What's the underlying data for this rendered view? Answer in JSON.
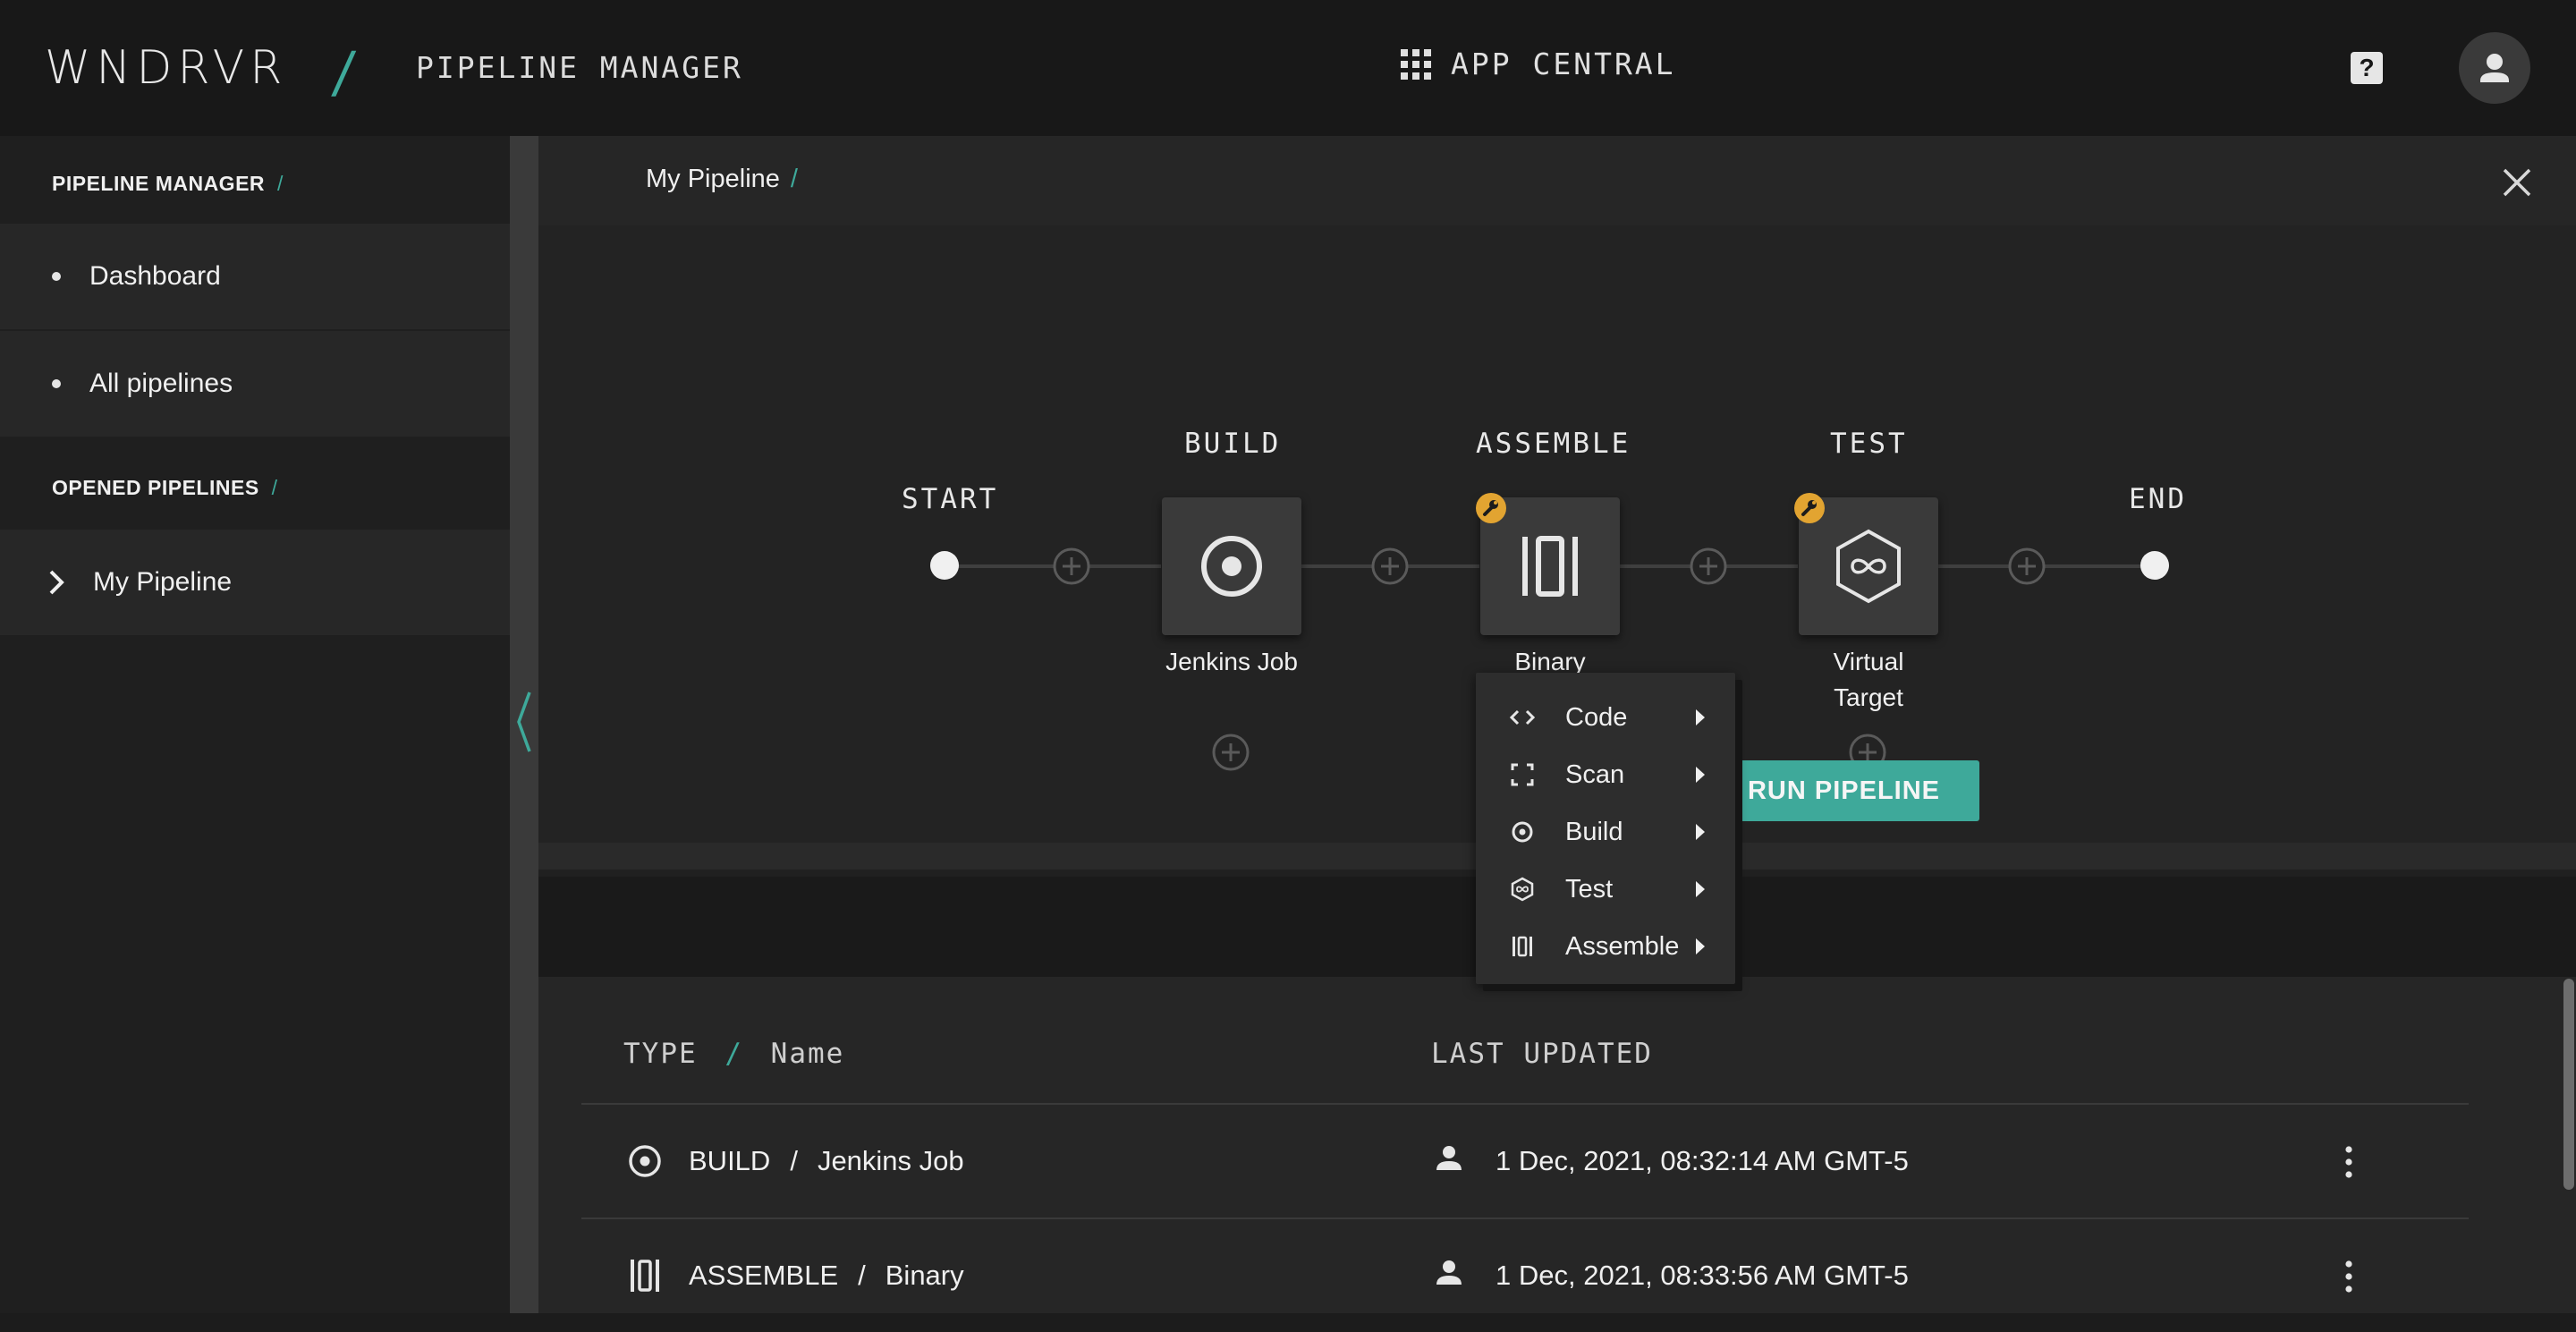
{
  "header": {
    "logo_text": "WNDRVR",
    "logo_slash": "/",
    "app_title": "PIPELINE MANAGER",
    "app_central": "APP CENTRAL",
    "help_icon": "question-mark-icon",
    "help_glyph": "?",
    "avatar_icon": "user-icon"
  },
  "sidebar": {
    "section_manager": "PIPELINE MANAGER",
    "section_opened": "OPENED PIPELINES",
    "slash": "/",
    "items": [
      {
        "label": "Dashboard"
      },
      {
        "label": "All pipelines"
      }
    ],
    "opened": [
      {
        "label": "My Pipeline"
      }
    ]
  },
  "breadcrumb": {
    "label": "My Pipeline",
    "slash": "/"
  },
  "pipeline": {
    "start_label": "START",
    "end_label": "END",
    "stages": [
      {
        "stage": "BUILD",
        "name": "Jenkins Job",
        "icon": "target-icon",
        "warning": false
      },
      {
        "stage": "ASSEMBLE",
        "name": "Binary",
        "icon": "binary-icon",
        "warning": true
      },
      {
        "stage": "TEST",
        "name_line1": "Virtual",
        "name_line2": "Target",
        "icon": "hexagon-infinity-icon",
        "warning": true
      }
    ]
  },
  "context_menu": {
    "items": [
      {
        "label": "Code",
        "icon": "code-icon"
      },
      {
        "label": "Scan",
        "icon": "scan-icon"
      },
      {
        "label": "Build",
        "icon": "target-icon"
      },
      {
        "label": "Test",
        "icon": "hexagon-infinity-icon"
      },
      {
        "label": "Assemble",
        "icon": "binary-icon"
      }
    ]
  },
  "actions": {
    "run_label": "RUN PIPELINE"
  },
  "table": {
    "col_type": "TYPE",
    "col_slash": "/",
    "col_name": "Name",
    "col_updated": "LAST UPDATED",
    "rows": [
      {
        "type": "BUILD",
        "sep": "/",
        "name": "Jenkins Job",
        "updated": "1 Dec, 2021, 08:32:14 AM GMT-5"
      },
      {
        "type": "ASSEMBLE",
        "sep": "/",
        "name": "Binary",
        "updated": "1 Dec, 2021, 08:33:56 AM GMT-5"
      }
    ]
  },
  "colors": {
    "accent": "#3ea99a",
    "warning": "#e2a431",
    "background": "#1c1c1c"
  }
}
